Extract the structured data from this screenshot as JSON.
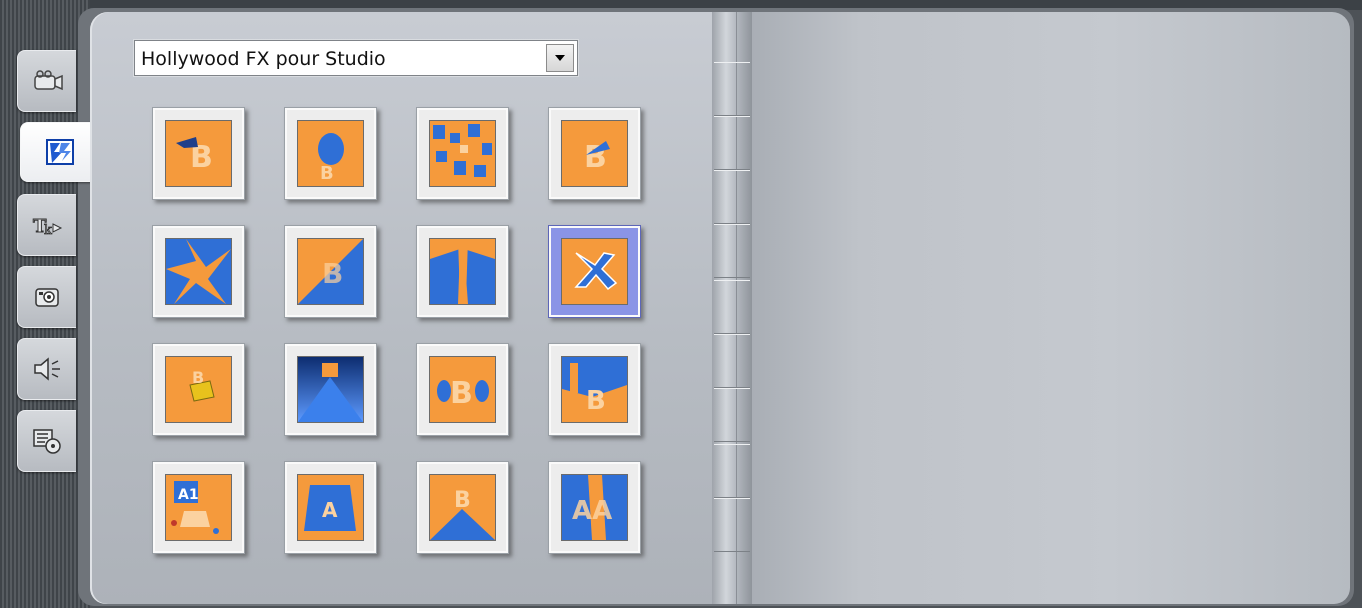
{
  "window": {
    "background": "#4d5257"
  },
  "dropdown": {
    "selected": "Hollywood FX pour Studio"
  },
  "tabs": [
    {
      "name": "video-icon",
      "active": false
    },
    {
      "name": "transitions-icon",
      "active": true
    },
    {
      "name": "titles-icon",
      "active": false
    },
    {
      "name": "photo-icon",
      "active": false
    },
    {
      "name": "audio-icon",
      "active": false
    },
    {
      "name": "menu-icon",
      "active": false
    }
  ],
  "thumbnails": [
    {
      "row": 1,
      "col": 1,
      "selected": false
    },
    {
      "row": 1,
      "col": 2,
      "selected": false
    },
    {
      "row": 1,
      "col": 3,
      "selected": false
    },
    {
      "row": 1,
      "col": 4,
      "selected": false
    },
    {
      "row": 2,
      "col": 1,
      "selected": false
    },
    {
      "row": 2,
      "col": 2,
      "selected": false
    },
    {
      "row": 2,
      "col": 3,
      "selected": false
    },
    {
      "row": 2,
      "col": 4,
      "selected": true
    },
    {
      "row": 3,
      "col": 1,
      "selected": false
    },
    {
      "row": 3,
      "col": 2,
      "selected": false
    },
    {
      "row": 3,
      "col": 3,
      "selected": false
    },
    {
      "row": 3,
      "col": 4,
      "selected": false
    },
    {
      "row": 4,
      "col": 1,
      "selected": false
    },
    {
      "row": 4,
      "col": 2,
      "selected": false
    },
    {
      "row": 4,
      "col": 3,
      "selected": false
    },
    {
      "row": 4,
      "col": 4,
      "selected": false
    }
  ],
  "colors": {
    "orange": "#f59a3c",
    "blue": "#2f6fd6",
    "selection": "#8a94e6"
  }
}
